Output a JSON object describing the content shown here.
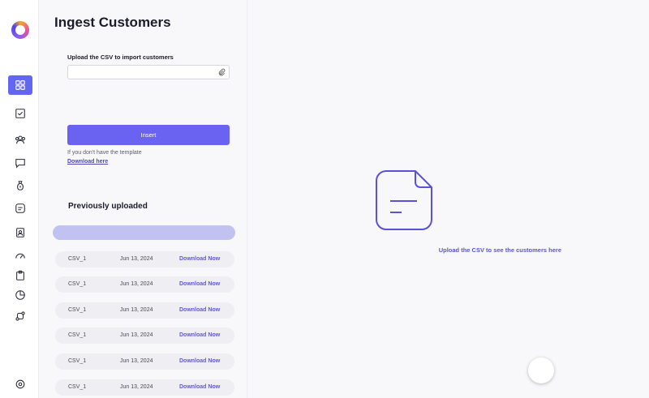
{
  "page": {
    "title": "Ingest Customers"
  },
  "upload": {
    "label": "Upload the CSV to import customers",
    "placeholder": "",
    "insert_label": "Insert",
    "template_hint": "If you don't have the template",
    "download_link": "Download here"
  },
  "history": {
    "title": "Previously uploaded",
    "rows": [
      {
        "name": "CSV_1",
        "date": "Jun 13, 2024",
        "action": "Download Now"
      },
      {
        "name": "CSV_1",
        "date": "Jun 13, 2024",
        "action": "Download Now"
      },
      {
        "name": "CSV_1",
        "date": "Jun 13, 2024",
        "action": "Download Now"
      },
      {
        "name": "CSV_1",
        "date": "Jun 13, 2024",
        "action": "Download Now"
      },
      {
        "name": "CSV_1",
        "date": "Jun 13, 2024",
        "action": "Download Now"
      },
      {
        "name": "CSV_1",
        "date": "Jun 13, 2024",
        "action": "Download Now"
      }
    ]
  },
  "main": {
    "empty_text": "Upload the CSV to see the customers here"
  },
  "sidebar": {
    "items": [
      {
        "icon": "dashboard-icon",
        "active": true
      },
      {
        "icon": "checklist-icon",
        "active": false
      },
      {
        "icon": "users-icon",
        "active": false
      },
      {
        "icon": "chat-icon",
        "active": false
      },
      {
        "icon": "money-bag-icon",
        "active": false
      },
      {
        "icon": "note-icon",
        "active": false
      },
      {
        "icon": "id-badge-icon",
        "active": false
      },
      {
        "icon": "gauge-icon",
        "active": false
      },
      {
        "icon": "clipboard-icon",
        "active": false
      },
      {
        "icon": "pie-chart-icon",
        "active": false
      },
      {
        "icon": "flow-icon",
        "active": false
      },
      {
        "icon": "settings-icon",
        "active": false
      }
    ]
  },
  "colors": {
    "accent": "#6a62f0",
    "accent_light": "#c2c2f2",
    "link": "#6158d8"
  }
}
